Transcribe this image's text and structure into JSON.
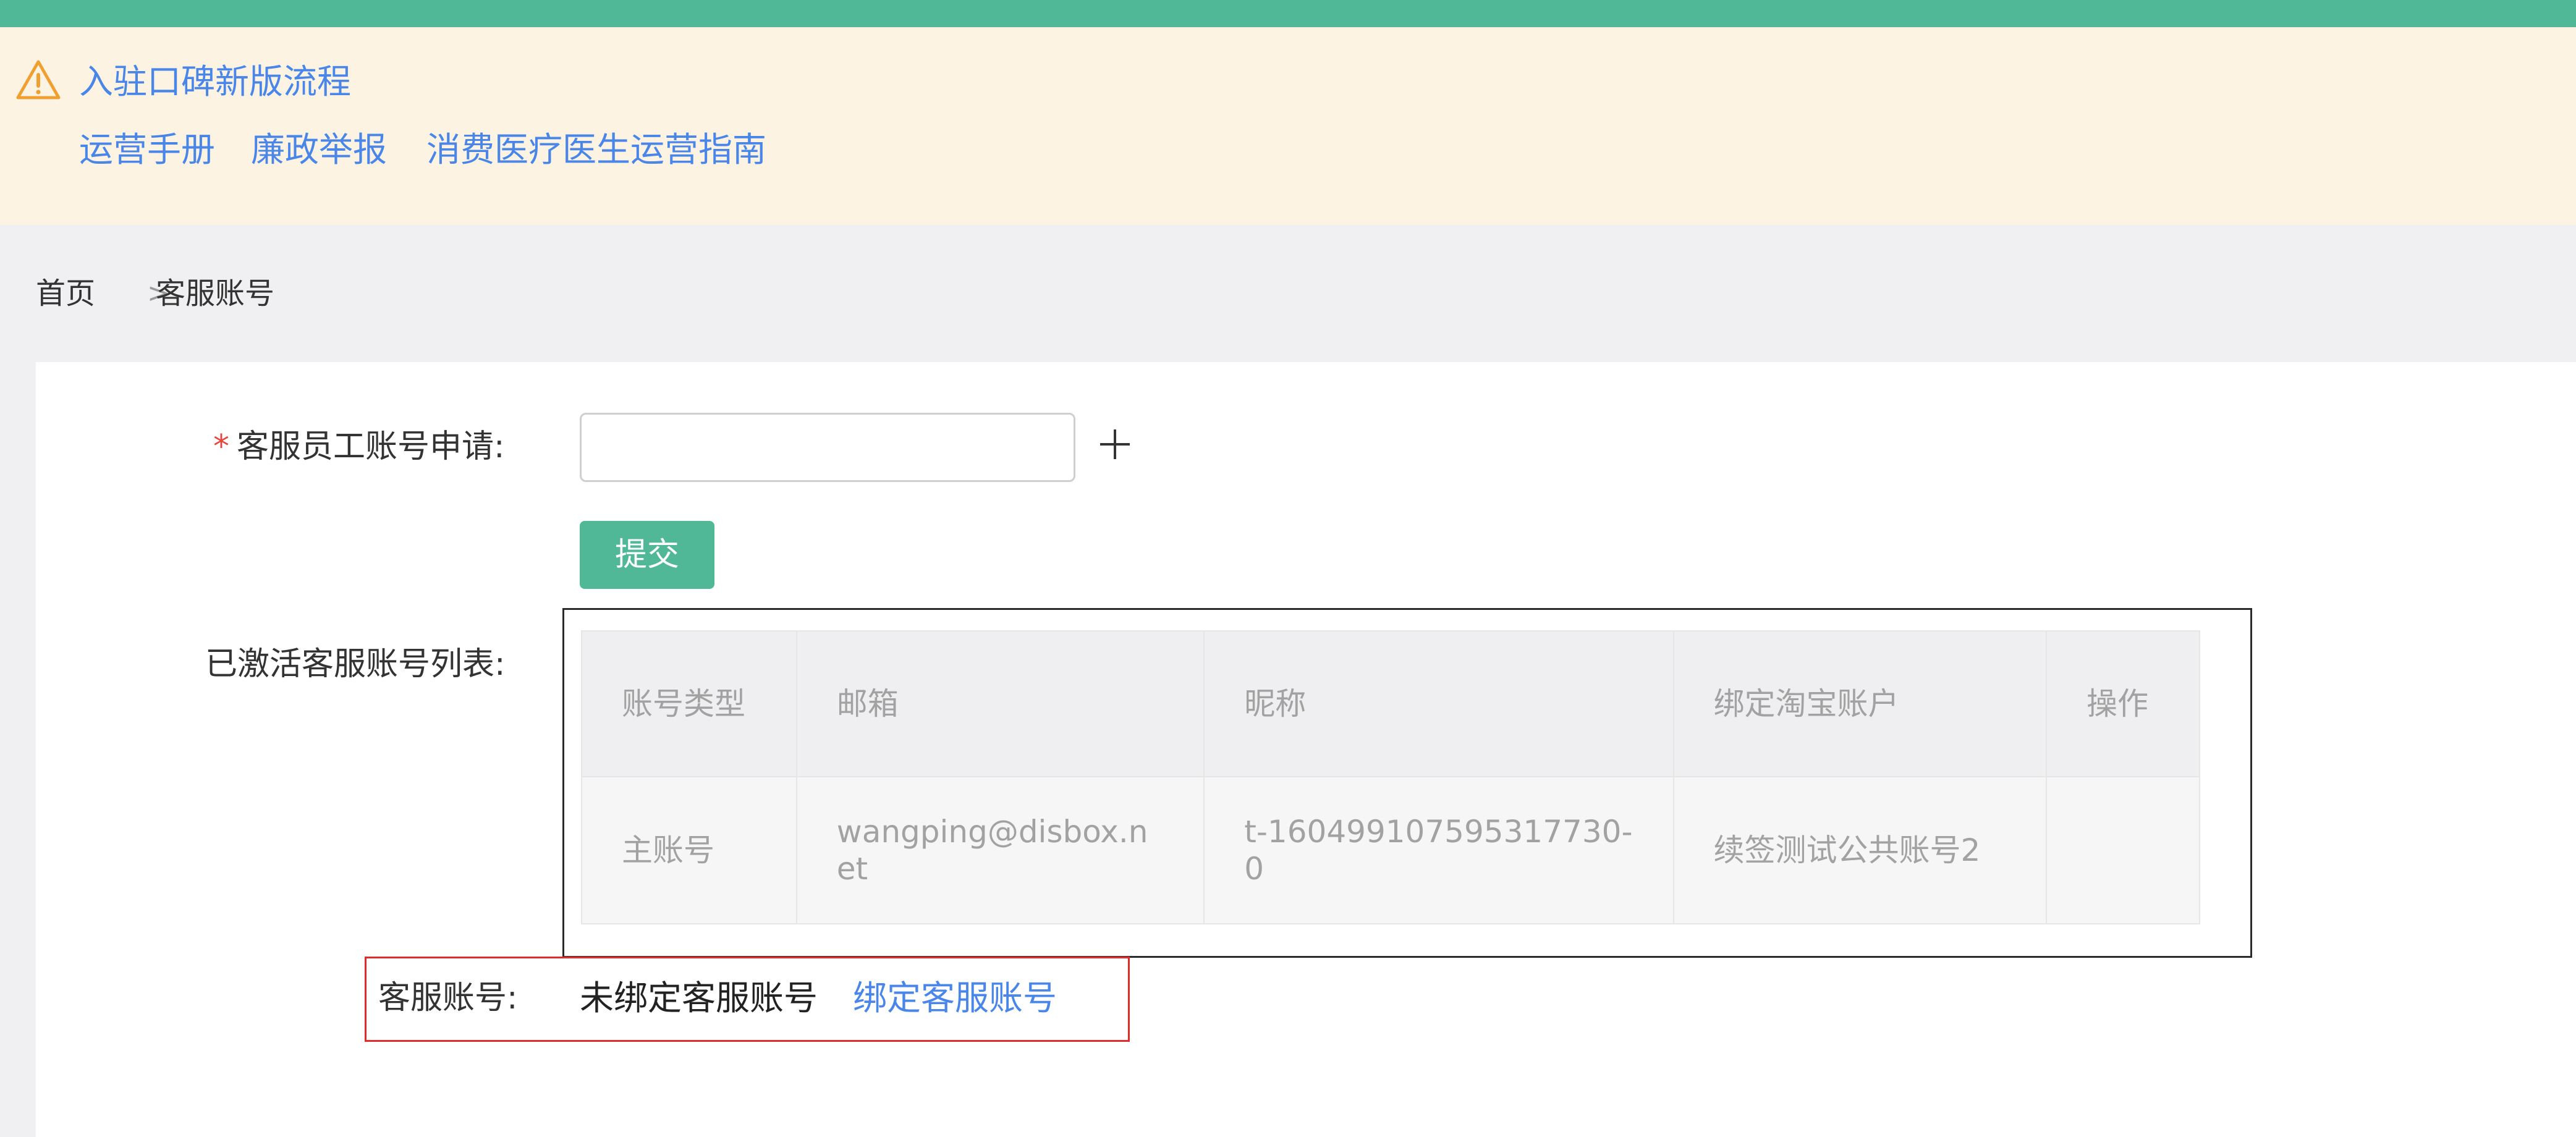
{
  "notice": {
    "headline": "入驻口碑新版流程",
    "links": [
      "运营手册",
      "廉政举报",
      "消费医疗医生运营指南"
    ],
    "icon": "warning-icon"
  },
  "breadcrumb": {
    "home": "首页",
    "separator": ">",
    "current": "客服账号"
  },
  "form": {
    "apply_label": "客服员工账号申请:",
    "required_mark": "*",
    "apply_input_value": "",
    "submit_label": "提交",
    "list_label": "已激活客服账号列表:"
  },
  "table": {
    "headers": [
      "账号类型",
      "邮箱",
      "昵称",
      "绑定淘宝账户",
      "操作"
    ],
    "rows": [
      {
        "type": "主账号",
        "email": "wangping@disbox.net",
        "nickname": "t-160499107595317730-0",
        "taobao": "续签测试公共账号2",
        "action": ""
      }
    ]
  },
  "service_account": {
    "label": "客服账号:",
    "status": "未绑定客服账号",
    "bind_link": "绑定客服账号"
  },
  "colors": {
    "brand": "#50b797",
    "link": "#4a86e8",
    "notice_bg": "#fcf3e3",
    "warning": "#f0a030",
    "required": "#e2483d",
    "highlight": "#e02b2b"
  }
}
